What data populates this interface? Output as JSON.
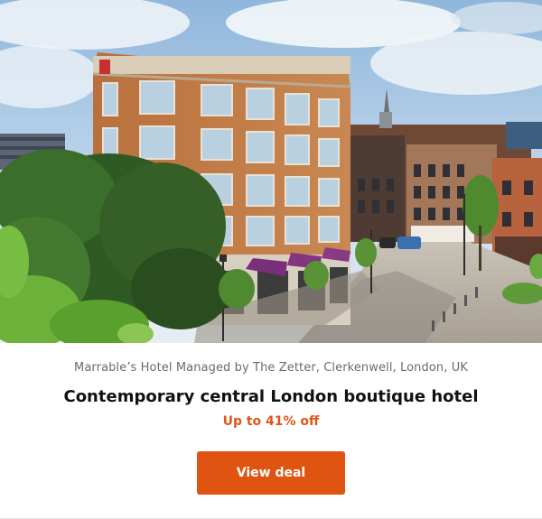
{
  "hero": {
    "image": "hotel-building-photo"
  },
  "offer": {
    "location": "Marrable’s Hotel Managed by The Zetter, Clerkenwell, London, UK",
    "headline": "Contemporary central London boutique hotel",
    "discount": "Up to 41% off",
    "cta_label": "View deal"
  },
  "colors": {
    "accent": "#de5410",
    "discount_text": "#e0561b",
    "muted_text": "#6b6b6b",
    "heading_text": "#111111"
  }
}
